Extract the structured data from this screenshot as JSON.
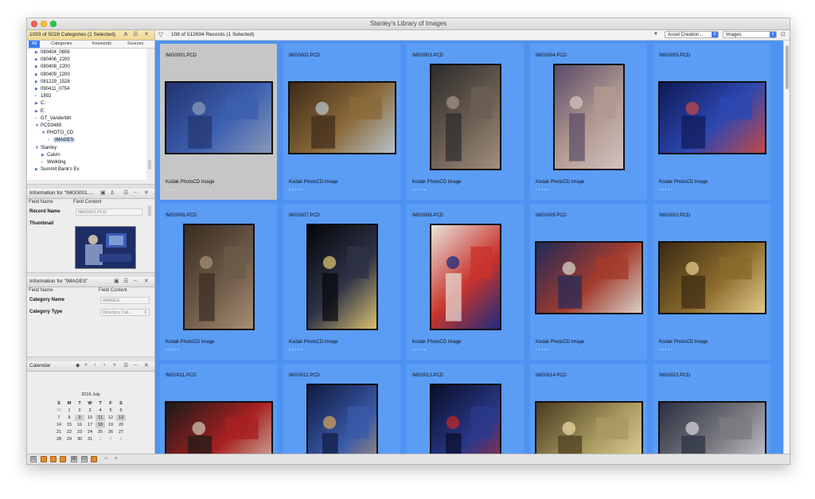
{
  "window": {
    "title": "Stanley's Library of Images"
  },
  "categories_panel": {
    "title": "1093 of 5028 Categories (1 Selected)",
    "tabs": [
      "All",
      "Categories",
      "Keywords",
      "Sources"
    ],
    "tree": [
      {
        "label": "080404_0656",
        "arrow": "right",
        "indent": 0
      },
      {
        "label": "080406_2200",
        "arrow": "right",
        "indent": 0
      },
      {
        "label": "080408_2200",
        "arrow": "right",
        "indent": 0
      },
      {
        "label": "080409_2200",
        "arrow": "right",
        "indent": 0
      },
      {
        "label": "081229_1528",
        "arrow": "right",
        "indent": 0
      },
      {
        "label": "090411_0754",
        "arrow": "right",
        "indent": 0
      },
      {
        "label": "1892",
        "arrow": "dot",
        "indent": 0
      },
      {
        "label": "C:",
        "arrow": "right",
        "indent": 0
      },
      {
        "label": "E:",
        "arrow": "right",
        "indent": 0
      },
      {
        "label": "GT_Vanderbilt",
        "arrow": "dot",
        "indent": 0
      },
      {
        "label": "PCD3489",
        "arrow": "down",
        "indent": 0
      },
      {
        "label": "PHOTO_CD",
        "arrow": "down",
        "indent": 1
      },
      {
        "label": "IMAGES",
        "arrow": "dot",
        "indent": 2,
        "selected": true
      },
      {
        "label": "Stanley",
        "arrow": "down",
        "indent": 0
      },
      {
        "label": "Calvin",
        "arrow": "right",
        "indent": 1
      },
      {
        "label": "Wedding",
        "arrow": "dot",
        "indent": 1
      },
      {
        "label": "Summit Bank's Ex",
        "arrow": "right",
        "indent": 0
      }
    ]
  },
  "record_info": {
    "title": "Information for \"IMG0001....",
    "col_field": "Field Name",
    "col_content": "Field Content",
    "record_name_label": "Record Name",
    "record_name_value": "IMG0001.PCD",
    "thumbnail_label": "Thumbnail"
  },
  "category_info": {
    "title": "Information for \"IMAGES\"",
    "col_field": "Field Name",
    "col_content": "Field Content",
    "category_name_label": "Category Name",
    "category_name_value": "IMAGES",
    "category_type_label": "Category Type",
    "category_type_value": "Directory Cat..."
  },
  "calendar": {
    "title": "Calendar",
    "month": "2019 July",
    "days_header": [
      "S",
      "M",
      "T",
      "W",
      "T",
      "F",
      "S"
    ],
    "weeks": [
      [
        "30",
        "1",
        "2",
        "3",
        "4",
        "5",
        "6"
      ],
      [
        "7",
        "8",
        "9",
        "10",
        "11",
        "12",
        "13"
      ],
      [
        "14",
        "15",
        "16",
        "17",
        "18",
        "19",
        "20"
      ],
      [
        "21",
        "22",
        "23",
        "24",
        "25",
        "26",
        "27"
      ],
      [
        "28",
        "29",
        "30",
        "31",
        "1",
        "2",
        "3"
      ]
    ],
    "highlighted": [
      "9",
      "11",
      "13",
      "18"
    ]
  },
  "toolbar": {
    "records_text": "108 of 512694 Records (1 Selected)",
    "sort_field": "Asset Creation...",
    "view_type": "Images"
  },
  "grid": {
    "caption": "Kodak PhotoCD Image",
    "items": [
      {
        "name": "IMG0001.PCD",
        "selected": true,
        "colors": [
          "#23346f",
          "#3c5fb0",
          "#8899b8"
        ]
      },
      {
        "name": "IMG0002.PCD",
        "colors": [
          "#3d2a18",
          "#8a6a3a",
          "#b6c2c8"
        ]
      },
      {
        "name": "IMG0003.PCD",
        "colors": [
          "#2b2b2b",
          "#6b5e52",
          "#a09080"
        ]
      },
      {
        "name": "IMG0004.PCD",
        "colors": [
          "#5a4a68",
          "#b09a90",
          "#d4c0c0"
        ]
      },
      {
        "name": "IMG0005.PCD",
        "colors": [
          "#101a55",
          "#2c47b0",
          "#c04848"
        ]
      },
      {
        "name": "IMG0006.PCD",
        "colors": [
          "#3a2c22",
          "#6e5a48",
          "#a58e74"
        ]
      },
      {
        "name": "IMG0007.PCD",
        "colors": [
          "#05060a",
          "#2e3246",
          "#d8c070"
        ]
      },
      {
        "name": "IMG0008.PCD",
        "colors": [
          "#e8e4dc",
          "#c8332c",
          "#1c2c80"
        ]
      },
      {
        "name": "IMG0009.PCD",
        "colors": [
          "#202a5a",
          "#a33b2c",
          "#d8d0c8"
        ]
      },
      {
        "name": "IMG0010.PCD",
        "colors": [
          "#3a2a14",
          "#8a6a2c",
          "#e0c888"
        ]
      },
      {
        "name": "IMG0011.PCD",
        "colors": [
          "#1a1a1a",
          "#a82020",
          "#d0c0b0"
        ]
      },
      {
        "name": "IMG0012.PCD",
        "colors": [
          "#101a40",
          "#3a5aa8",
          "#d0a060"
        ]
      },
      {
        "name": "IMG0013.PCD",
        "colors": [
          "#0a0e2a",
          "#2a3a8a",
          "#c02828"
        ]
      },
      {
        "name": "IMG0014.PCD",
        "colors": [
          "#4a3a20",
          "#a89a60",
          "#e8d8a0"
        ]
      },
      {
        "name": "IMG0015.PCD",
        "colors": [
          "#2a3040",
          "#7a7a80",
          "#d0d0d8"
        ]
      }
    ]
  },
  "accent": "#4f93f2"
}
